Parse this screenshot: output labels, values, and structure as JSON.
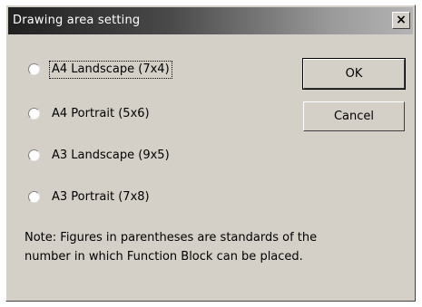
{
  "dialog": {
    "title": "Drawing area setting",
    "close_label": "×"
  },
  "options": [
    {
      "label": "A4 Landscape (7x4)",
      "selected": false,
      "focused": true
    },
    {
      "label": "A4 Portrait (5x6)",
      "selected": false,
      "focused": false
    },
    {
      "label": "A3 Landscape (9x5)",
      "selected": false,
      "focused": false
    },
    {
      "label": "A3 Portrait (7x8)",
      "selected": false,
      "focused": false
    }
  ],
  "buttons": {
    "ok_label": "OK",
    "cancel_label": "Cancel"
  },
  "note": {
    "line1": "Note: Figures in parentheses are standards of the",
    "line2": "number in which Function Block can be placed."
  }
}
